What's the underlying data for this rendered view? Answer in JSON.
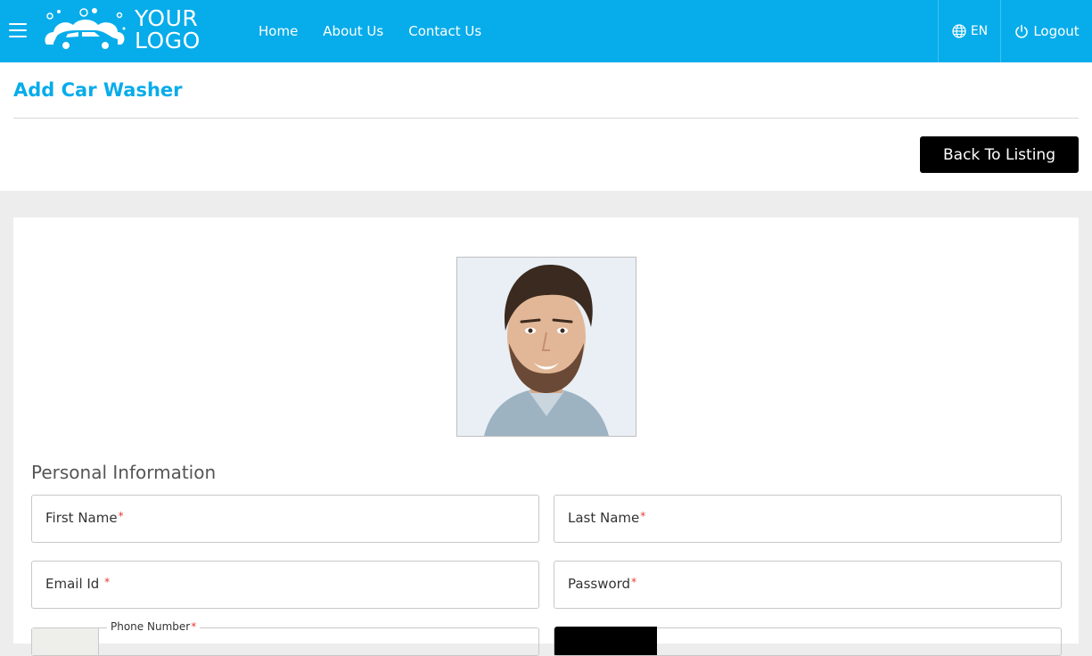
{
  "header": {
    "logo_line1": "YOUR",
    "logo_line2": "LOGO",
    "nav": [
      "Home",
      "About Us",
      "Contact Us"
    ],
    "language": "EN",
    "logout_label": "Logout",
    "brand_color": "#07acea"
  },
  "page": {
    "title": "Add Car Washer",
    "back_button": "Back To Listing"
  },
  "form": {
    "section_title": "Personal Information",
    "first_name_label": "First Name",
    "last_name_label": "Last Name",
    "email_label": "Email Id",
    "password_label": "Password",
    "phone_label": "Phone Number",
    "required_mark": "*"
  }
}
